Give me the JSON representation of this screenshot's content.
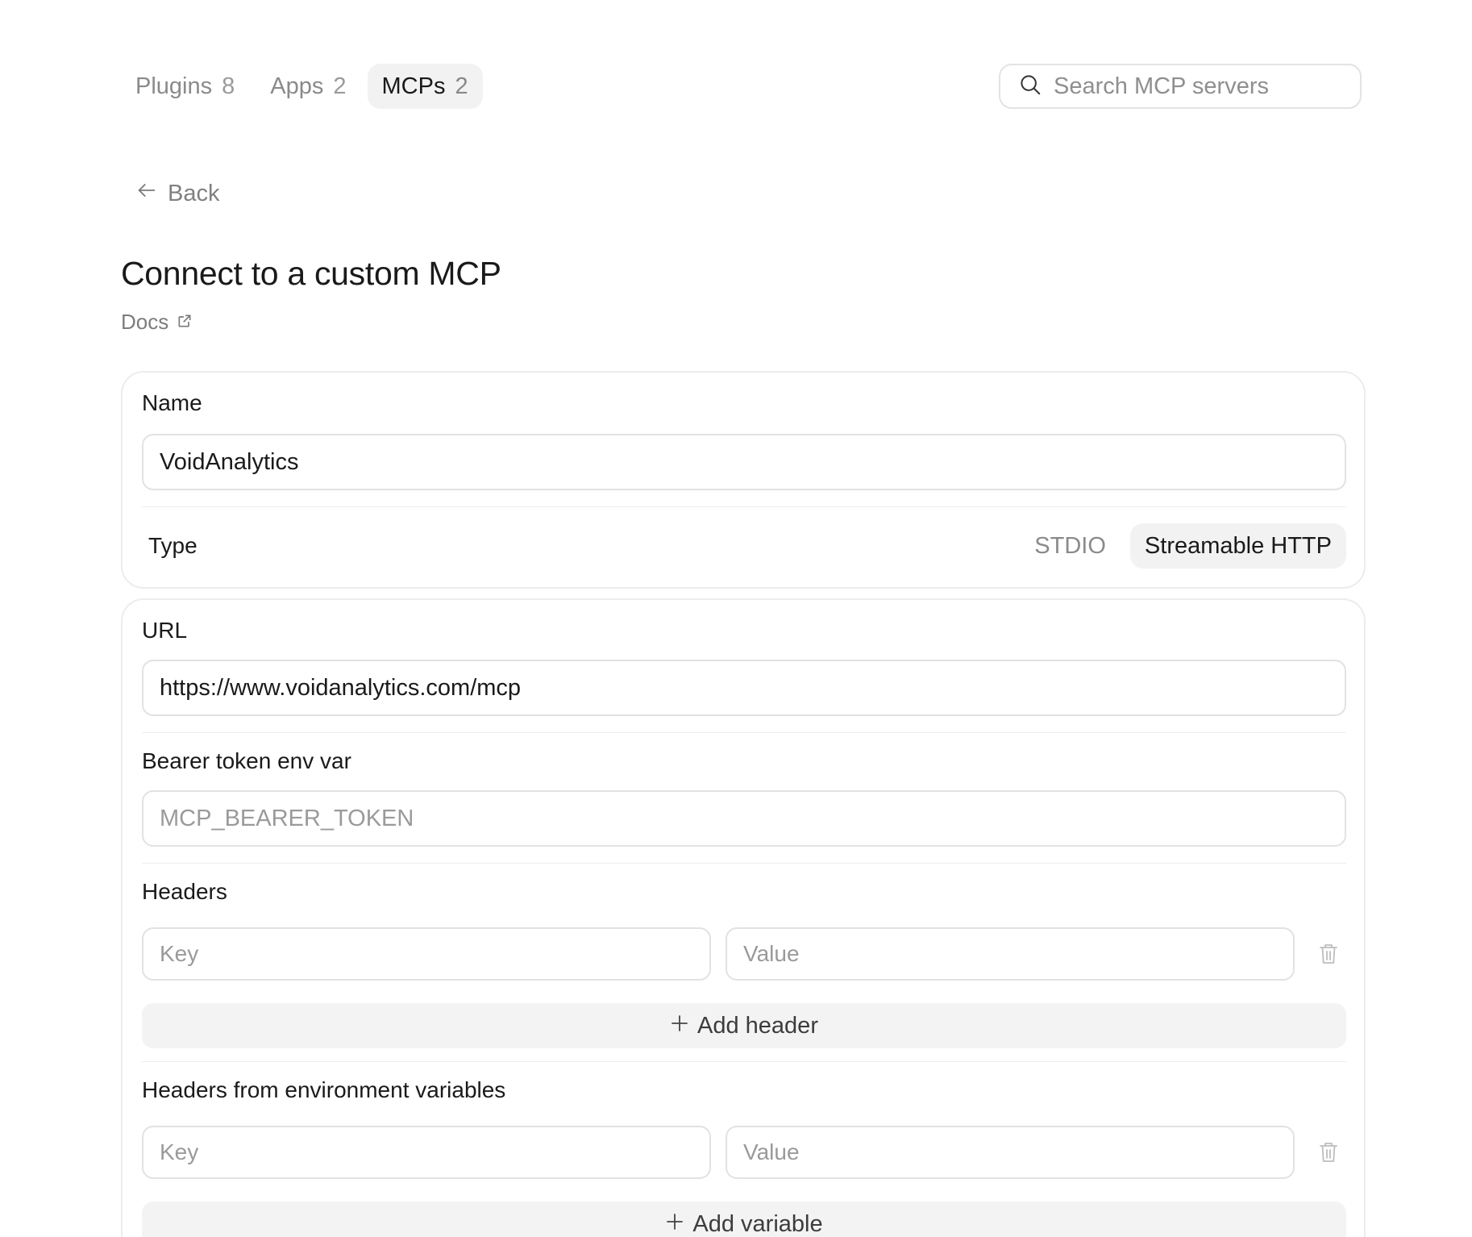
{
  "tabs": [
    {
      "label": "Plugins",
      "count": "8"
    },
    {
      "label": "Apps",
      "count": "2"
    },
    {
      "label": "MCPs",
      "count": "2"
    }
  ],
  "search": {
    "placeholder": "Search MCP servers"
  },
  "back": {
    "label": "Back"
  },
  "page": {
    "title": "Connect to a custom MCP",
    "docs_label": "Docs"
  },
  "form": {
    "name": {
      "label": "Name",
      "value": "VoidAnalytics"
    },
    "type": {
      "label": "Type",
      "options": [
        "STDIO",
        "Streamable HTTP"
      ],
      "selected": "Streamable HTTP"
    },
    "url": {
      "label": "URL",
      "value": "https://www.voidanalytics.com/mcp"
    },
    "bearer": {
      "label": "Bearer token env var",
      "placeholder": "MCP_BEARER_TOKEN"
    },
    "headers": {
      "label": "Headers",
      "key_placeholder": "Key",
      "value_placeholder": "Value",
      "add_label": "Add header"
    },
    "env_headers": {
      "label": "Headers from environment variables",
      "key_placeholder": "Key",
      "value_placeholder": "Value",
      "add_label": "Add variable"
    }
  },
  "colors": {
    "active_tab_bg": "#f2f2f2",
    "border": "#e2e2e2",
    "muted_text": "#8a8a8a",
    "button_bg": "#f3f3f3"
  },
  "icons": {
    "search": "search-icon",
    "back": "arrow-left-icon",
    "docs": "external-link-icon",
    "delete": "trash-icon",
    "add": "plus-icon"
  }
}
